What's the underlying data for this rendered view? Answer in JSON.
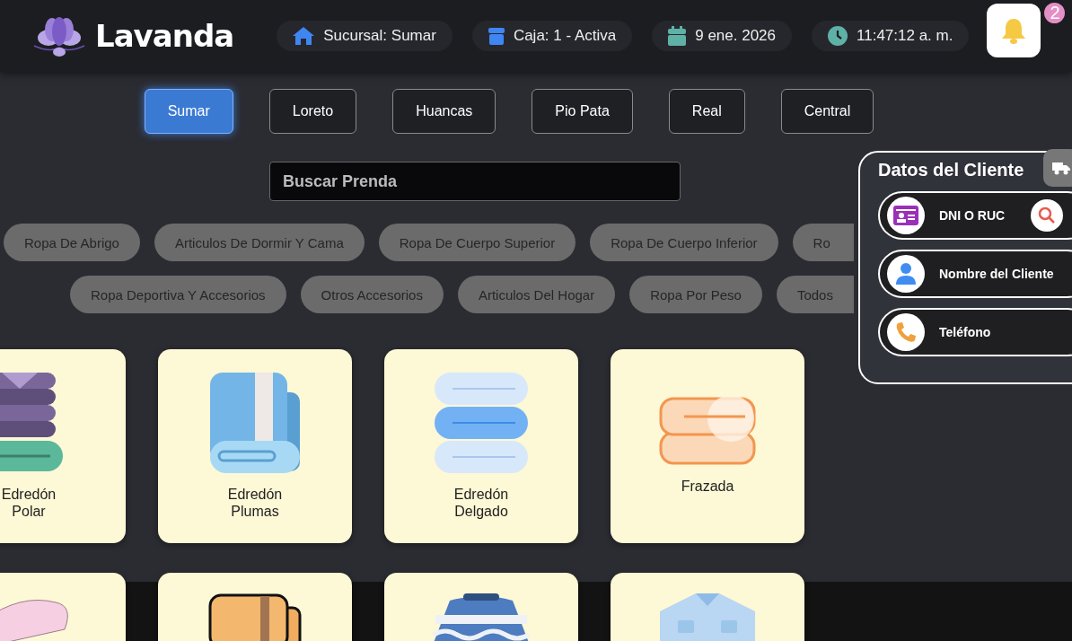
{
  "brand": {
    "name": "Lavanda"
  },
  "header_chips": [
    {
      "kind": "branch",
      "text": "Sucursal: Sumar"
    },
    {
      "kind": "register",
      "text": "Caja: 1 - Activa"
    },
    {
      "kind": "date",
      "text": "9 ene. 2026"
    },
    {
      "kind": "time",
      "text": "11:47:12 a. m."
    }
  ],
  "notifications": {
    "count": "2"
  },
  "branch_tabs": [
    {
      "label": "Sumar",
      "selected": true
    },
    {
      "label": "Loreto",
      "selected": false
    },
    {
      "label": "Huancas",
      "selected": false
    },
    {
      "label": "Pio Pata",
      "selected": false
    },
    {
      "label": "Real",
      "selected": false
    },
    {
      "label": "Central",
      "selected": false
    }
  ],
  "search": {
    "placeholder": "Buscar Prenda"
  },
  "category_rows": [
    [
      "Ropa De Abrigo",
      "Articulos De Dormir Y Cama",
      "Ropa De Cuerpo Superior",
      "Ropa De Cuerpo Inferior",
      "Ro"
    ],
    [
      "Ropa Deportiva Y Accesorios",
      "Otros Accesorios",
      "Articulos Del Hogar",
      "Ropa Por Peso",
      "Todos"
    ]
  ],
  "garments": [
    {
      "kind": "polar",
      "name": "Edredón\nPolar"
    },
    {
      "kind": "feather",
      "name": "Edredón\nPlumas"
    },
    {
      "kind": "thin",
      "name": "Edredón\nDelgado"
    },
    {
      "kind": "blanket",
      "name": "Frazada"
    },
    {
      "kind": "pink"
    },
    {
      "kind": "towel"
    },
    {
      "kind": "sweater"
    },
    {
      "kind": "shirt"
    }
  ],
  "client_panel": {
    "title": "Datos del Cliente",
    "fields": [
      {
        "kind": "id",
        "placeholder": "DNI O RUC"
      },
      {
        "kind": "person",
        "placeholder": "Nombre del Cliente"
      },
      {
        "kind": "phone",
        "placeholder": "Teléfono"
      }
    ]
  }
}
